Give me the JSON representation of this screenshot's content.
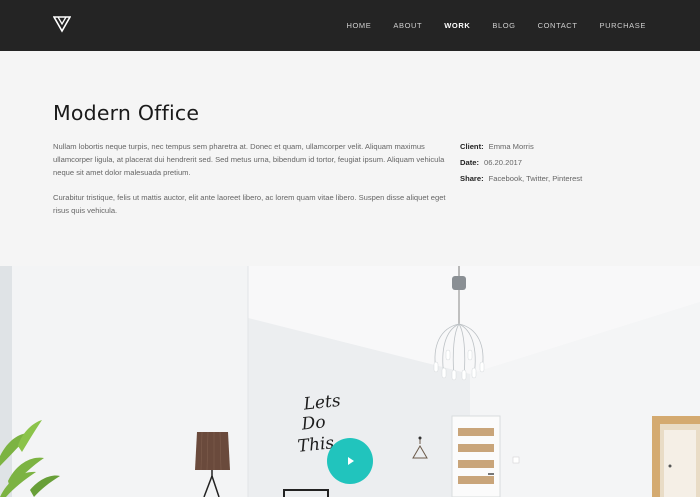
{
  "nav": {
    "logo_icon": "triangle-logo-icon",
    "items": [
      {
        "label": "HOME",
        "active": false
      },
      {
        "label": "ABOUT",
        "active": false
      },
      {
        "label": "WORK",
        "active": true
      },
      {
        "label": "BLOG",
        "active": false
      },
      {
        "label": "CONTACT",
        "active": false
      },
      {
        "label": "PURCHASE",
        "active": false
      }
    ]
  },
  "project": {
    "title": "Modern Office",
    "paragraphs": [
      "Nullam lobortis neque turpis, nec tempus sem pharetra at. Donec et quam, ullamcorper velit. Aliquam maximus ullamcorper ligula, at placerat dui hendrerit sed. Sed metus urna, bibendum id tortor, feugiat ipsum. Aliquam vehicula neque sit amet dolor malesuada pretium.",
      "Curabitur tristique, felis ut mattis auctor, elit ante laoreet libero, ac lorem quam vitae libero. Suspen disse aliquet eget risus quis vehicula."
    ],
    "meta": [
      {
        "label": "Client:",
        "value": "Emma Morris"
      },
      {
        "label": "Date:",
        "value": "06.20.2017"
      },
      {
        "label": "Share:",
        "value": "Facebook, Twitter, Pinterest"
      }
    ]
  },
  "hero": {
    "play_icon": "play-icon",
    "accent_color": "#21c4bd",
    "wall_text": "Lets Do This"
  },
  "colors": {
    "navbar_bg": "#242424",
    "page_bg": "#f5f5f5",
    "accent": "#21c4bd"
  }
}
